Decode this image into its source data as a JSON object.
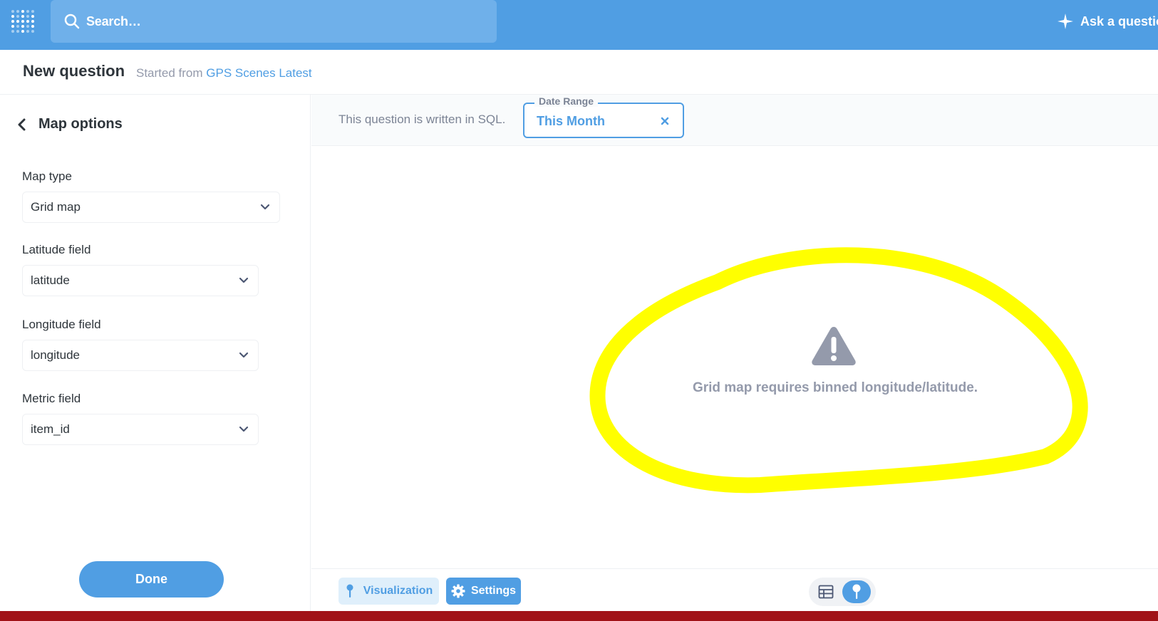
{
  "nav": {
    "search_placeholder": "Search…",
    "ask_label": "Ask a question"
  },
  "header": {
    "title": "New question",
    "subtitle_prefix": "Started from",
    "source_link": "GPS Scenes Latest"
  },
  "sidebar": {
    "heading": "Map options",
    "fields": [
      {
        "label": "Map type",
        "value": "Grid map"
      },
      {
        "label": "Latitude field",
        "value": "latitude"
      },
      {
        "label": "Longitude field",
        "value": "longitude"
      },
      {
        "label": "Metric field",
        "value": "item_id"
      }
    ],
    "done_label": "Done"
  },
  "filterbar": {
    "sql_note": "This question is written in SQL.",
    "date_range_label": "Date Range",
    "date_range_value": "This Month"
  },
  "canvas": {
    "message": "Grid map requires binned longitude/latitude."
  },
  "footer": {
    "visualization_label": "Visualization",
    "settings_label": "Settings"
  },
  "colors": {
    "brand": "#509ee3",
    "highlight": "#ffff00",
    "bottom_bar": "#a11218"
  },
  "icons": [
    "metabase-logo-icon",
    "search-icon",
    "sparkle-icon",
    "chevron-left-icon",
    "chevron-down-icon",
    "close-icon",
    "warning-icon",
    "pin-icon",
    "gear-icon",
    "table-icon",
    "map-pin-icon"
  ]
}
